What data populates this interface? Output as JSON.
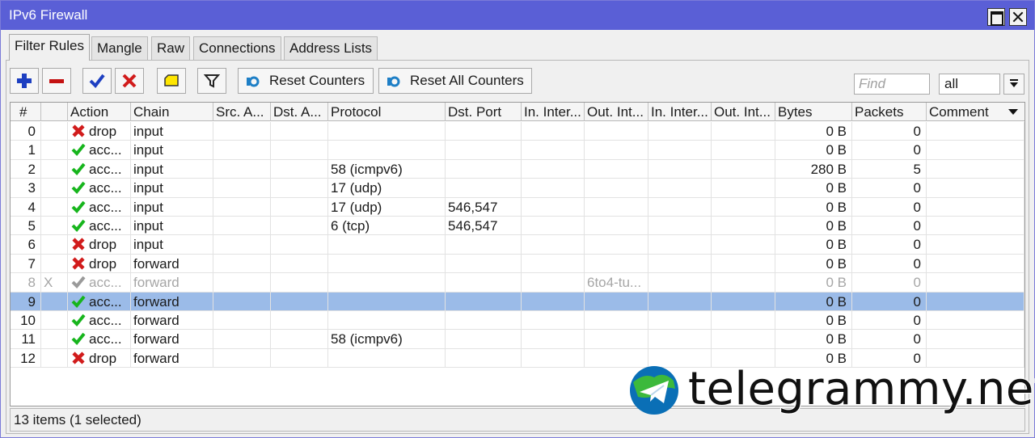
{
  "window": {
    "title": "IPv6 Firewall"
  },
  "tabs": [
    {
      "label": "Filter Rules"
    },
    {
      "label": "Mangle"
    },
    {
      "label": "Raw"
    },
    {
      "label": "Connections"
    },
    {
      "label": "Address Lists"
    }
  ],
  "toolbar": {
    "add_icon": "plus-icon",
    "remove_icon": "minus-icon",
    "enable_icon": "check-icon",
    "disable_icon": "x-icon",
    "comment_icon": "note-icon",
    "filter_icon": "filter-icon",
    "reset_counters": "Reset Counters",
    "reset_all_counters": "Reset All Counters",
    "find_placeholder": "Find",
    "filter_select": "all"
  },
  "columns": [
    "#",
    "",
    "Action",
    "Chain",
    "Src. A...",
    "Dst. A...",
    "Protocol",
    "Dst. Port",
    "In. Inter...",
    "Out. Int...",
    "In. Inter...",
    "Out. Int...",
    "Bytes",
    "Packets",
    "Comment"
  ],
  "rows": [
    {
      "num": "0",
      "flag": "",
      "action": "drop",
      "chain": "input",
      "protocol": "",
      "dst_port": "",
      "out_int": "",
      "bytes": "0 B",
      "packets": "0",
      "state": "normal"
    },
    {
      "num": "1",
      "flag": "",
      "action": "acc...",
      "chain": "input",
      "protocol": "",
      "dst_port": "",
      "out_int": "",
      "bytes": "0 B",
      "packets": "0",
      "state": "normal"
    },
    {
      "num": "2",
      "flag": "",
      "action": "acc...",
      "chain": "input",
      "protocol": "58 (icmpv6)",
      "dst_port": "",
      "out_int": "",
      "bytes": "280 B",
      "packets": "5",
      "state": "normal"
    },
    {
      "num": "3",
      "flag": "",
      "action": "acc...",
      "chain": "input",
      "protocol": "17 (udp)",
      "dst_port": "",
      "out_int": "",
      "bytes": "0 B",
      "packets": "0",
      "state": "normal"
    },
    {
      "num": "4",
      "flag": "",
      "action": "acc...",
      "chain": "input",
      "protocol": "17 (udp)",
      "dst_port": "546,547",
      "out_int": "",
      "bytes": "0 B",
      "packets": "0",
      "state": "normal"
    },
    {
      "num": "5",
      "flag": "",
      "action": "acc...",
      "chain": "input",
      "protocol": "6 (tcp)",
      "dst_port": "546,547",
      "out_int": "",
      "bytes": "0 B",
      "packets": "0",
      "state": "normal"
    },
    {
      "num": "6",
      "flag": "",
      "action": "drop",
      "chain": "input",
      "protocol": "",
      "dst_port": "",
      "out_int": "",
      "bytes": "0 B",
      "packets": "0",
      "state": "normal"
    },
    {
      "num": "7",
      "flag": "",
      "action": "drop",
      "chain": "forward",
      "protocol": "",
      "dst_port": "",
      "out_int": "",
      "bytes": "0 B",
      "packets": "0",
      "state": "normal"
    },
    {
      "num": "8",
      "flag": "X",
      "action": "acc...",
      "chain": "forward",
      "protocol": "",
      "dst_port": "",
      "out_int": "6to4-tu...",
      "bytes": "0 B",
      "packets": "0",
      "state": "disabled"
    },
    {
      "num": "9",
      "flag": "",
      "action": "acc...",
      "chain": "forward",
      "protocol": "",
      "dst_port": "",
      "out_int": "",
      "bytes": "0 B",
      "packets": "0",
      "state": "selected"
    },
    {
      "num": "10",
      "flag": "",
      "action": "acc...",
      "chain": "forward",
      "protocol": "",
      "dst_port": "",
      "out_int": "",
      "bytes": "0 B",
      "packets": "0",
      "state": "normal"
    },
    {
      "num": "11",
      "flag": "",
      "action": "acc...",
      "chain": "forward",
      "protocol": "58 (icmpv6)",
      "dst_port": "",
      "out_int": "",
      "bytes": "0 B",
      "packets": "0",
      "state": "normal"
    },
    {
      "num": "12",
      "flag": "",
      "action": "drop",
      "chain": "forward",
      "protocol": "",
      "dst_port": "",
      "out_int": "",
      "bytes": "0 B",
      "packets": "0",
      "state": "normal"
    }
  ],
  "status": {
    "text": "13 items (1 selected)"
  },
  "watermark": {
    "text": "telegrammy.net",
    "logo_icon": "telegram-globe-icon"
  },
  "colors": {
    "titlebar": "#5a5fd6",
    "selected_row": "#9bbbe8",
    "accept_icon": "#17b51d",
    "drop_icon": "#d11b1b",
    "disabled_text": "#a6a6a6"
  }
}
